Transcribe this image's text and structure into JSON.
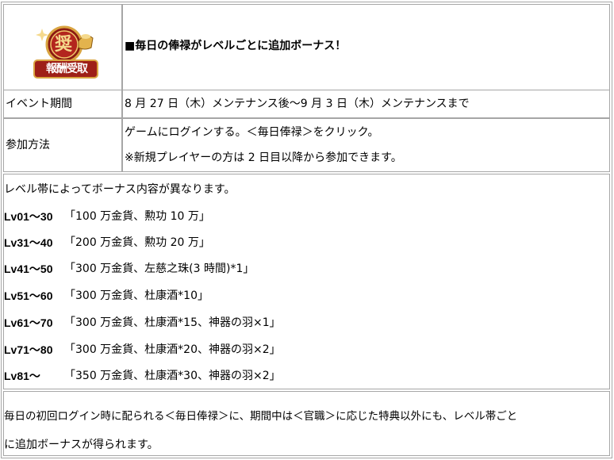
{
  "header": {
    "icon_text": "報酬受取",
    "icon_glyph": "奨",
    "title": "■毎日の俸禄がレベルごとに追加ボーナス！"
  },
  "period": {
    "label": "イベント期間",
    "value": "8 月 27 日（木）メンテナンス後～9 月 3 日（木）メンテナンスまで"
  },
  "method": {
    "label": "参加方法",
    "line1": "ゲームにログインする。＜毎日俸禄＞をクリック。",
    "line2": "※新規プレイヤーの方は 2 日目以降から参加できます。"
  },
  "bonus": {
    "intro": "レベル帯によってボーナス内容が異なります。",
    "rows": [
      {
        "level": "Lv01～30",
        "reward": "「100 万金貨、勲功 10 万」"
      },
      {
        "level": "Lv31～40",
        "reward": "「200 万金貨、勲功 20 万」"
      },
      {
        "level": "Lv41～50",
        "reward": "「300 万金貨、左慈之珠(3 時間)*1」"
      },
      {
        "level": "Lv51～60",
        "reward": "「300 万金貨、杜康酒*10」"
      },
      {
        "level": "Lv61～70",
        "reward": "「300 万金貨、杜康酒*15、神器の羽×1」"
      },
      {
        "level": "Lv71～80",
        "reward": "「300 万金貨、杜康酒*20、神器の羽×2」"
      },
      {
        "level": "Lv81～",
        "reward": "「350 万金貨、杜康酒*30、神器の羽×2」"
      }
    ]
  },
  "note": {
    "line1": "毎日の初回ログイン時に配られる＜毎日俸禄＞に、期間中は＜官職＞に応じた特典以外にも、レベル帯ごと",
    "line2": "に追加ボーナスが得られます。"
  },
  "colors": {
    "border": "#a6a6a6",
    "icon_red": "#b3261e",
    "icon_gold": "#d9a441"
  }
}
